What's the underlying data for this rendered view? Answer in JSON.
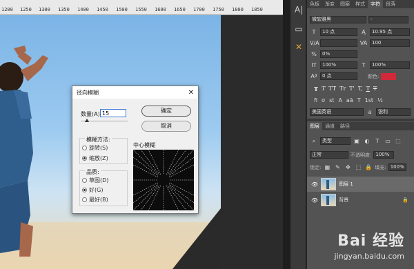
{
  "ruler": {
    "ticks": [
      "1200",
      "1250",
      "1300",
      "1350",
      "1400",
      "1450",
      "1500",
      "1550",
      "1600",
      "1650",
      "1700",
      "1750",
      "1800",
      "1850"
    ]
  },
  "panel_tabs": [
    "色板",
    "渐变",
    "图案",
    "样式",
    "字符",
    "段落"
  ],
  "character": {
    "font_family": "微软雅黑",
    "font_style": "-",
    "size": "10 点",
    "leading": "10.95 点",
    "kerning": "",
    "tracking": "100",
    "scale_pct": "0%",
    "vscale": "100%",
    "hscale": "100%",
    "baseline": "0 点",
    "color_label": "颜色:",
    "color_hex": "#d1293a",
    "style_buttons": [
      "T",
      "T",
      "TT",
      "Tr",
      "T'",
      "T,",
      "T",
      "T"
    ],
    "glyph_buttons": [
      "fi",
      "σ",
      "st",
      "A",
      "aā",
      "T",
      "1st",
      "½"
    ],
    "language": "美国英语",
    "aa_icon": "a",
    "antialias": "锐利"
  },
  "layers": {
    "tabs": [
      "图层",
      "通道",
      "路径"
    ],
    "filter_kind": "类型",
    "blend_mode": "正常",
    "opacity_label": "不透明度:",
    "opacity_value": "100%",
    "lock_label": "锁定:",
    "fill_label": "填充:",
    "fill_value": "100%",
    "items": [
      {
        "name": "图层 1",
        "thumb_char": "1",
        "selected": true
      },
      {
        "name": "背景",
        "thumb_char": "1",
        "selected": false
      }
    ]
  },
  "dialog": {
    "title": "径向模糊",
    "amount_label": "数量(A)",
    "amount_value": "15",
    "ok_label": "确定",
    "cancel_label": "取消",
    "method_label": "模糊方法:",
    "methods": [
      "旋转(S)",
      "缩放(Z)"
    ],
    "method_selected": 1,
    "quality_label": "品质:",
    "qualities": [
      "草图(D)",
      "好(G)",
      "最好(B)"
    ],
    "quality_selected": 1,
    "center_label": "中心模糊"
  },
  "watermark": {
    "brand": "Bai 经验",
    "url": "jingyan.baidu.com"
  }
}
